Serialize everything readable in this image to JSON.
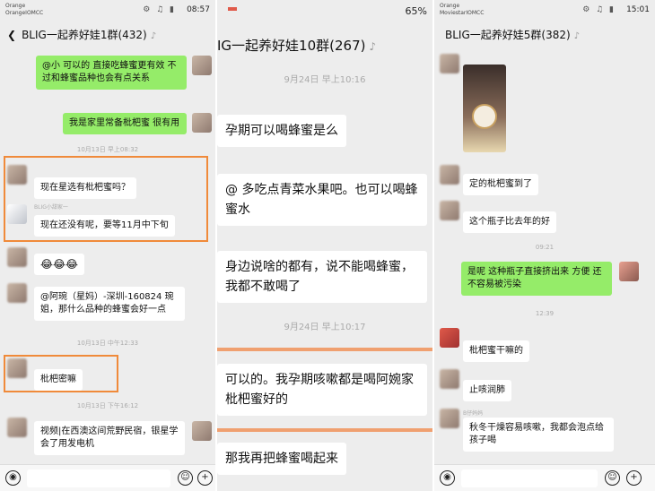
{
  "panel1": {
    "operator": "Orange",
    "operator2": "OrangeIOMCC",
    "time": "08:57",
    "title": "BLIG一起养好娃1群(432)",
    "messages": {
      "m1": "@小 可以的 直接吃蜂蜜更有效 不过和蜂蜜品种也会有点关系",
      "m2": "我是家里常备枇杷蜜 很有用",
      "ts1": "10月13日 早上08:32",
      "m3": "现在星选有枇杷蜜吗？",
      "nick3": "BLIG小甜家一",
      "m4": "现在还没有呢，要等11月中下旬",
      "m5": "😂😂😂",
      "m6": "@阿琬（星妈）-深圳-160824 琬姐，那什么品种的蜂蜜会好一点",
      "ts2": "10月13日 中午12:33",
      "m7": "枇杷密嘛",
      "ts3": "10月13日 下午16:12",
      "m8": "视频|在西澳这间荒野民宿，银星学会了用发电机"
    }
  },
  "panel2": {
    "title": "IG一起养好娃10群(267)",
    "battery": "65%",
    "messages": {
      "ts1": "9月24日 早上10:16",
      "m1": "孕期可以喝蜂蜜是么",
      "m2": "@ 多吃点青菜水果吧。也可以喝蜂蜜水",
      "m3": "身边说啥的都有，说不能喝蜂蜜，我都不敢喝了",
      "ts2": "9月24日 早上10:17",
      "m4": "可以的。我孕期咳嗽都是喝阿婉家枇杷蜜好的",
      "m5": "那我再把蜂蜜喝起来"
    }
  },
  "panel3": {
    "operator": "Orange",
    "operator2": "MoviestarIOMCC",
    "time": "15:01",
    "title": "BLIG一起养好娃5群(382)",
    "messages": {
      "m1": "定的枇杷蜜到了",
      "m2": "这个瓶子比去年的好",
      "ts1": "09:21",
      "m3": "是呢 这种瓶子直接挤出来 方便 还不容易被污染",
      "ts2": "12:39",
      "m4": "枇杷蜜干嘛的",
      "m5": "止咳润肺",
      "nick6": "B仔妈妈",
      "m6": "秋冬干燥容易咳嗽，我都会泡点给孩子喝"
    }
  },
  "icons": [
    "back-icon",
    "mute-icon",
    "voice-icon",
    "emoji-icon",
    "plus-icon"
  ]
}
